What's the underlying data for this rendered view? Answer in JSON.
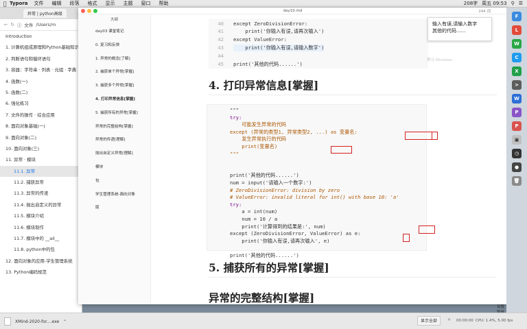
{
  "menubar": {
    "app": "Typora",
    "items": [
      "文件",
      "编辑",
      "段落",
      "格式",
      "显示",
      "主题",
      "窗口",
      "帮助"
    ],
    "status_text": "208字",
    "clock": "周五 09:53"
  },
  "browser": {
    "tab_title": "异常 | python高级",
    "address_label": "文件",
    "address_path": "/Users/m",
    "toc": [
      {
        "label": "Introduction",
        "level": 0,
        "active": false
      },
      {
        "label": "1. 计算机组成原理和Python基础知识",
        "level": 0,
        "active": false
      },
      {
        "label": "2. 判断语句和循环语句",
        "level": 0,
        "active": false
      },
      {
        "label": "3. 容器：字符串 · 列表 · 元组 · 字典",
        "level": 0,
        "active": false
      },
      {
        "label": "4. 函数(一)",
        "level": 0,
        "active": false
      },
      {
        "label": "5. 函数(二)",
        "level": 0,
        "active": false
      },
      {
        "label": "6. 强化练习",
        "level": 0,
        "active": false
      },
      {
        "label": "7. 文件的操作 · 综合应用",
        "level": 0,
        "active": false
      },
      {
        "label": "8. 面向对象基础(一)",
        "level": 0,
        "active": false
      },
      {
        "label": "9. 面向对象(二)",
        "level": 0,
        "active": false
      },
      {
        "label": "10. 面向对象(三)",
        "level": 0,
        "active": false
      },
      {
        "label": "11. 异常 · 模块",
        "level": 0,
        "active": false
      },
      {
        "label": "11.1. 异常",
        "level": 1,
        "active": true
      },
      {
        "label": "11.2. 捕获异常",
        "level": 1,
        "active": false
      },
      {
        "label": "11.3. 异常的传递",
        "level": 1,
        "active": false
      },
      {
        "label": "11.4. 抛出自定义的异常",
        "level": 1,
        "active": false
      },
      {
        "label": "11.5. 模块介绍",
        "level": 1,
        "active": false
      },
      {
        "label": "11.6. 模块制作",
        "level": 1,
        "active": false
      },
      {
        "label": "11.7. 模块中的 __all__",
        "level": 1,
        "active": false
      },
      {
        "label": "11.8. python中的包",
        "level": 1,
        "active": false
      },
      {
        "label": "12. 面向对象的应用-学生管理系统",
        "level": 0,
        "active": false
      },
      {
        "label": "13. Python编码规范",
        "level": 0,
        "active": false
      }
    ]
  },
  "typora": {
    "filename": "day10.md",
    "wordcount": "244 词",
    "outline_title": "大纲",
    "outline": [
      {
        "label": "day03 课堂笔记",
        "active": false
      },
      {
        "label": "0. 复习和反馈",
        "active": false
      },
      {
        "label": "1. 异常的概念[了解]",
        "active": false
      },
      {
        "label": "2. 捕获单个异常[掌握]",
        "active": false
      },
      {
        "label": "3. 捕获多个异常[掌握]",
        "active": false
      },
      {
        "label": "4. 打印异常信息[掌握]",
        "active": true
      },
      {
        "label": "5. 捕获所有的异常[掌握]",
        "active": false
      },
      {
        "label": "异常的完整结构[掌握]",
        "active": false
      },
      {
        "label": "异常的传递[理解]",
        "active": false
      },
      {
        "label": "抛出自定义异常[理解]",
        "active": false
      },
      {
        "label": "模块",
        "active": false
      },
      {
        "label": "包",
        "active": false
      },
      {
        "label": "学生管理系统-面向对象",
        "active": false
      },
      {
        "label": "版",
        "active": false
      }
    ],
    "code_block_1": {
      "line_numbers": [
        "40",
        "41",
        "42",
        "43",
        "44",
        "45"
      ],
      "lines": [
        "except ZeroDivisionError:",
        "    print('你输入有误,请再次输入')",
        "except ValueError:",
        "    print('你输入有误,请输入数字')",
        "",
        "print('其他的代码......')"
      ]
    },
    "tooltip_lines": [
      "输入有误,请输入数字",
      "其他的代码......"
    ],
    "watermark": "黑马 Windows",
    "heading_4": "4. 打印异常信息[掌握]",
    "code_block_2": {
      "lines": [
        "\"\"\"",
        "try:",
        "    可能发生异常的代码",
        "except (异常的类型1, 异常类型2, ...) as 变量名:",
        "    发生异常执行的代码",
        "    print(变量名)",
        "\"\"\"",
        "",
        "",
        "print('其他的代码......')",
        "num = input('请输入一个数字:')",
        "# ZeroDivisionError: division by zero",
        "# ValueError: invalid literal for int() with base 10: 'a'",
        "try:",
        "    a = int(num)",
        "    num = 10 / a",
        "    print('计算得到的结果是:', num)",
        "except (ZeroDivisionError, ValueError) as e:",
        "    print('你输入有误,请再次输入', e)",
        "",
        "print('其他的代码......')"
      ]
    },
    "heading_5": "5. 捕获所有的异常[掌握]",
    "heading_6": "异常的完整结构[掌握]"
  },
  "downloads": {
    "file": "XMind-2020-for....exe",
    "show_all": "显示全部",
    "close": "×"
  },
  "status": {
    "time": "00:00:00",
    "cpu": "CPU: 1.4%, 5.00 fps",
    "side_a": "设置",
    "side_b": "暂停"
  },
  "colors": {
    "keyword": "#770088",
    "string": "#aa1111",
    "comment": "#aa5500",
    "highlight_box": "#d62020"
  }
}
